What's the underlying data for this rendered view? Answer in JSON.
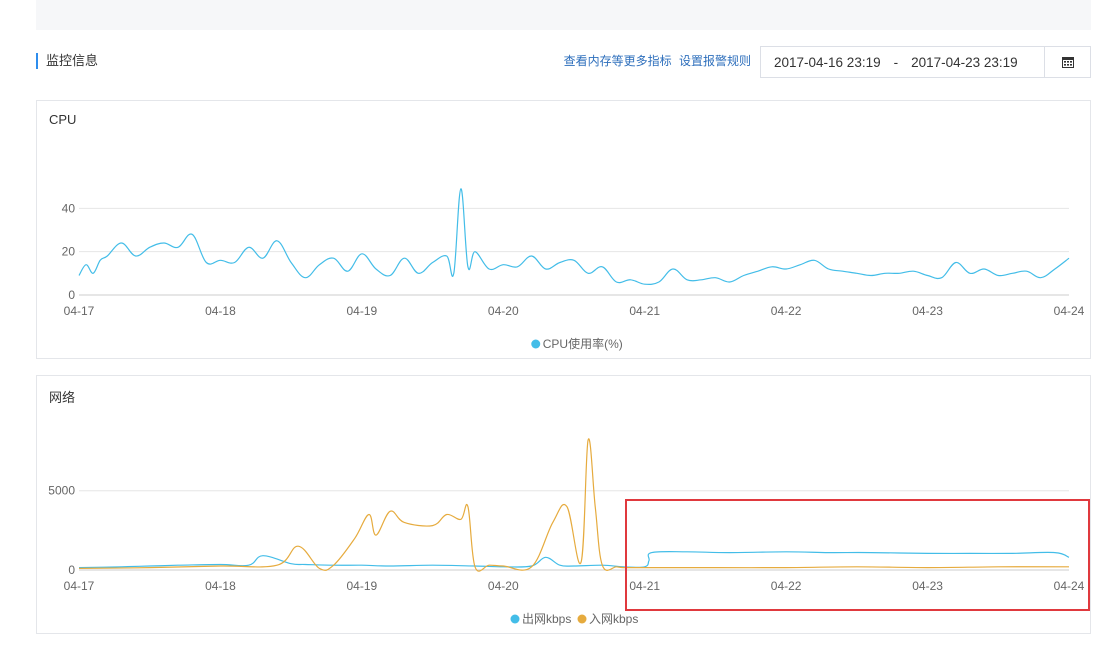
{
  "header": {
    "title": "监控信息",
    "link_more": "查看内存等更多指标",
    "link_alarm": "设置报警规则",
    "date_start": "2017-04-16 23:19",
    "date_sep": "-",
    "date_end": "2017-04-23 23:19",
    "calendar_icon": "calendar-icon"
  },
  "colors": {
    "accent": "#2e8ded",
    "series_blue": "#43bde8",
    "series_orange": "#e6ab3e",
    "highlight": "#e0393e"
  },
  "cpu_panel": {
    "title": "CPU"
  },
  "net_panel": {
    "title": "网络"
  },
  "chart_data": [
    {
      "type": "line",
      "title": "CPU",
      "x_ticks": [
        "04-17",
        "04-18",
        "04-19",
        "04-20",
        "04-21",
        "04-22",
        "04-23",
        "04-24"
      ],
      "y_ticks": [
        0,
        20,
        40
      ],
      "ylim": [
        0,
        60
      ],
      "xlim": [
        0,
        7
      ],
      "grid": true,
      "legend_position": "bottom-center",
      "series": [
        {
          "name": "CPU使用率(%)",
          "color": "#43bde8",
          "x": [
            0,
            0.05,
            0.1,
            0.15,
            0.2,
            0.3,
            0.4,
            0.5,
            0.6,
            0.7,
            0.8,
            0.9,
            1.0,
            1.1,
            1.2,
            1.3,
            1.4,
            1.5,
            1.6,
            1.7,
            1.8,
            1.9,
            2.0,
            2.1,
            2.2,
            2.3,
            2.4,
            2.5,
            2.6,
            2.65,
            2.7,
            2.75,
            2.8,
            2.9,
            3.0,
            3.1,
            3.2,
            3.3,
            3.4,
            3.5,
            3.6,
            3.7,
            3.8,
            3.9,
            4.0,
            4.1,
            4.2,
            4.3,
            4.4,
            4.5,
            4.6,
            4.7,
            4.8,
            4.9,
            5.0,
            5.1,
            5.2,
            5.3,
            5.4,
            5.5,
            5.6,
            5.7,
            5.8,
            5.9,
            6.0,
            6.1,
            6.2,
            6.3,
            6.4,
            6.5,
            6.6,
            6.7,
            6.8,
            6.9,
            7.0
          ],
          "y": [
            9,
            14,
            10,
            16,
            18,
            24,
            18,
            22,
            24,
            22,
            28,
            15,
            16,
            15,
            22,
            17,
            25,
            15,
            8,
            14,
            17,
            11,
            19,
            12,
            9,
            17,
            10,
            15,
            18,
            10,
            49,
            13,
            20,
            12,
            14,
            13,
            18,
            12,
            15,
            16,
            10,
            13,
            6,
            7,
            5,
            6,
            12,
            7,
            7,
            8,
            6,
            9,
            11,
            13,
            12,
            14,
            16,
            12,
            11,
            10,
            9,
            10,
            10,
            11,
            9,
            8,
            15,
            10,
            12,
            9,
            10,
            11,
            8,
            12,
            17
          ]
        }
      ]
    },
    {
      "type": "line",
      "title": "网络",
      "x_ticks": [
        "04-17",
        "04-18",
        "04-19",
        "04-20",
        "04-21",
        "04-22",
        "04-23",
        "04-24"
      ],
      "y_ticks": [
        0,
        5000
      ],
      "ylim": [
        0,
        8200
      ],
      "xlim": [
        0,
        7
      ],
      "grid": true,
      "legend_position": "bottom-center",
      "series": [
        {
          "name": "出网kbps",
          "color": "#43bde8",
          "x": [
            0,
            0.3,
            0.5,
            0.7,
            1.0,
            1.2,
            1.3,
            1.5,
            1.6,
            1.8,
            2.0,
            2.2,
            2.5,
            2.8,
            3.0,
            3.2,
            3.3,
            3.4,
            3.5,
            3.7,
            3.85,
            4.0,
            4.03,
            4.05,
            4.3,
            4.6,
            5.0,
            5.3,
            5.6,
            6.0,
            6.3,
            6.6,
            6.9,
            7.0
          ],
          "y": [
            150,
            200,
            250,
            300,
            350,
            300,
            900,
            400,
            350,
            300,
            300,
            250,
            300,
            250,
            200,
            250,
            800,
            300,
            250,
            300,
            200,
            200,
            600,
            1100,
            1150,
            1100,
            1150,
            1100,
            1100,
            1050,
            1050,
            1050,
            1100,
            800
          ]
        },
        {
          "name": "入网kbps",
          "color": "#e6ab3e",
          "x": [
            0,
            0.5,
            1.0,
            1.4,
            1.55,
            1.7,
            1.8,
            1.95,
            2.05,
            2.1,
            2.2,
            2.3,
            2.5,
            2.6,
            2.7,
            2.75,
            2.8,
            2.9,
            3.0,
            3.2,
            3.35,
            3.45,
            3.55,
            3.6,
            3.65,
            3.7,
            3.8,
            3.85,
            3.9,
            4.0,
            4.5,
            5.0,
            5.5,
            6.0,
            6.5,
            7.0
          ],
          "y": [
            100,
            150,
            250,
            300,
            1500,
            100,
            300,
            2000,
            3500,
            2200,
            3700,
            3000,
            2800,
            3500,
            3200,
            4000,
            200,
            300,
            250,
            200,
            3000,
            4000,
            500,
            8200,
            4000,
            300,
            200,
            150,
            150,
            150,
            150,
            150,
            200,
            150,
            200,
            200
          ]
        }
      ]
    }
  ]
}
